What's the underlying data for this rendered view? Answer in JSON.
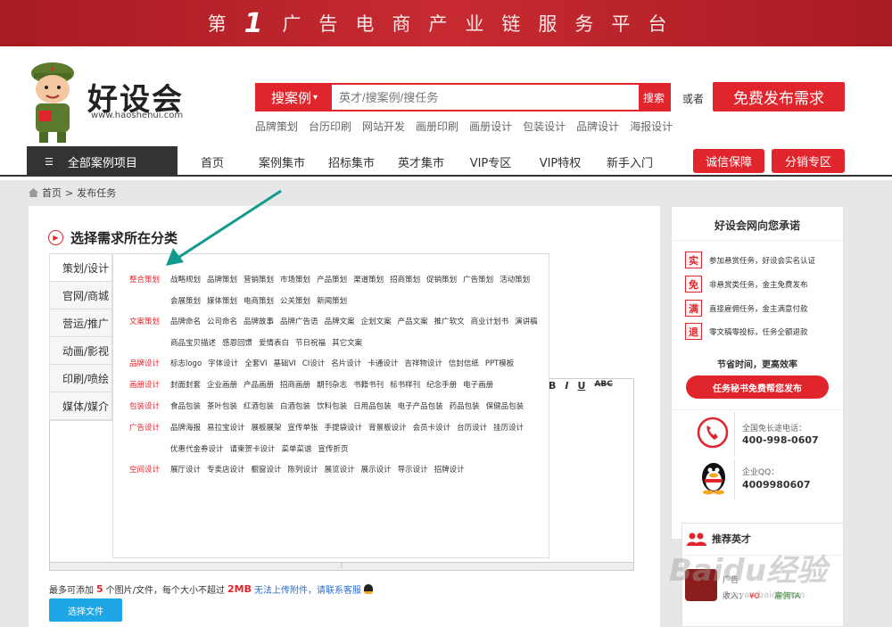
{
  "banner": {
    "prefix": "第",
    "number": "1",
    "suffix": "广告电商产业链服务平台"
  },
  "logo": {
    "name": "好设会",
    "url": "www.haoshehui.com"
  },
  "search": {
    "type_label": "搜案例",
    "type_arrow": "▾",
    "placeholder": "英才/搜案例/搜任务",
    "button": "搜索"
  },
  "or_text": "或者",
  "publish_button": "免费发布需求",
  "hotwords": [
    "品牌策划",
    "台历印刷",
    "网站开发",
    "画册印刷",
    "画册设计",
    "包装设计",
    "品牌设计",
    "海报设计"
  ],
  "nav": {
    "all_label": "全部案例项目",
    "items": [
      "首页",
      "案例集市",
      "招标集市",
      "英才集市",
      "VIP专区",
      "VIP特权",
      "新手入门"
    ],
    "btn_trust": "诚信保障",
    "btn_dist": "分销专区"
  },
  "breadcrumb": {
    "home": "首页",
    "sep": ">",
    "current": "发布任务"
  },
  "section_title": "选择需求所在分类",
  "categories": [
    "策划/设计",
    "官网/商城",
    "营运/推广",
    "动画/影视",
    "印刷/喷绘",
    "媒体/媒介"
  ],
  "subcategories": [
    {
      "label": "整合策划",
      "items": [
        "战略规划",
        "品牌策划",
        "营销策划",
        "市场策划",
        "产品策划",
        "渠道策划",
        "招商策划",
        "促销策划",
        "广告策划",
        "活动策划",
        "会展策划",
        "媒体策划",
        "电商策划",
        "公关策划",
        "新闻策划"
      ]
    },
    {
      "label": "文案策划",
      "items": [
        "品牌命名",
        "公司命名",
        "品牌故事",
        "品牌广告语",
        "品牌文案",
        "企划文案",
        "产品文案",
        "推广软文",
        "商业计划书",
        "演讲稿",
        "商品宝贝描述",
        "感恩回馈",
        "爱情表白",
        "节日祝福",
        "其它文案"
      ]
    },
    {
      "label": "品牌设计",
      "items": [
        "标志logo",
        "字体设计",
        "全套VI",
        "基础VI",
        "CI设计",
        "名片设计",
        "卡通设计",
        "吉祥物设计",
        "信封信纸",
        "PPT模板"
      ]
    },
    {
      "label": "画册设计",
      "items": [
        "封面封套",
        "企业画册",
        "产品画册",
        "招商画册",
        "期刊杂志",
        "书籍书刊",
        "标书样刊",
        "纪念手册",
        "电子画册"
      ]
    },
    {
      "label": "包装设计",
      "items": [
        "食品包装",
        "茶叶包装",
        "红酒包装",
        "白酒包装",
        "饮料包装",
        "日用品包装",
        "电子产品包装",
        "药品包装",
        "保健品包装"
      ]
    },
    {
      "label": "广告设计",
      "items": [
        "品牌海报",
        "易拉宝设计",
        "展板展架",
        "宣传单张",
        "手提袋设计",
        "背景板设计",
        "会员卡设计",
        "台历设计",
        "挂历设计",
        "优惠代金券设计",
        "请柬贺卡设计",
        "菜单菜谱",
        "宣传折页"
      ]
    },
    {
      "label": "空间设计",
      "items": [
        "展厅设计",
        "专卖店设计",
        "橱窗设计",
        "陈列设计",
        "展览设计",
        "展示设计",
        "导示设计",
        "招牌设计"
      ]
    }
  ],
  "editor_toolbar": [
    "B",
    "I",
    "U",
    "ABC"
  ],
  "upload": {
    "prefix": "最多可添加",
    "count": "5",
    "mid": "个图片/文件，每个大小不超过",
    "size": "2MB",
    "link": "无法上传附件，请联系客服",
    "button": "选择文件"
  },
  "promise": {
    "title": "好设会网向您承诺",
    "items": [
      {
        "icon": "实",
        "text": "参加悬赏任务，好设会实名认证"
      },
      {
        "icon": "免",
        "text": "非悬赏类任务，金主免费发布"
      },
      {
        "icon": "满",
        "text": "直接雇佣任务，金主满意付款"
      },
      {
        "icon": "退",
        "text": "零文稿零投标，任务全额退款"
      }
    ],
    "save_time": "节省时间，更高效率",
    "secretary_button": "任务秘书免费帮您发布",
    "phone_label": "全国免长途电话：",
    "phone": "400-998-0607",
    "qq_label": "企业QQ：",
    "qq": "4009980607"
  },
  "talent": {
    "title": "推荐英才",
    "income_label": "收入：",
    "income": "¥0",
    "hire": "雇佣TA",
    "prefix": "广告"
  },
  "watermark": {
    "text": "Baidu经验",
    "url": "jingyan.baidu.com"
  },
  "colors": {
    "brand_red": "#e0252d",
    "banner_red": "#b41e26",
    "upload_blue": "#1ea6e6",
    "arrow_teal": "#139a8e"
  }
}
